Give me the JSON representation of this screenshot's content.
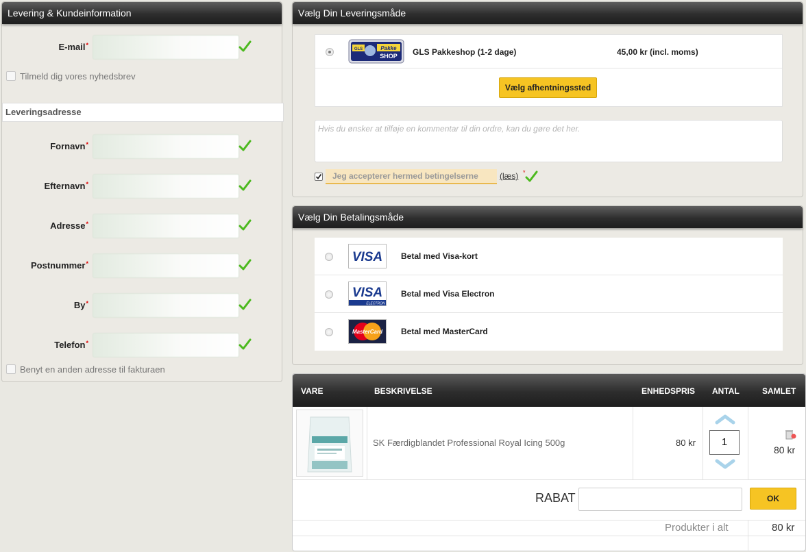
{
  "left_panel": {
    "title": "Levering & Kundeinformation",
    "email_label": "E-mail",
    "email_value": "",
    "newsletter_label": "Tilmeld dig vores nyhedsbrev",
    "section_title": "Leveringsadresse",
    "fields": [
      {
        "label": "Fornavn",
        "value": ""
      },
      {
        "label": "Efternavn",
        "value": ""
      },
      {
        "label": "Adresse",
        "value": ""
      },
      {
        "label": "Postnummer",
        "value": ""
      },
      {
        "label": "By",
        "value": ""
      },
      {
        "label": "Telefon",
        "value": ""
      }
    ],
    "required_mark": "*",
    "alt_address_label": "Benyt en anden adresse til fakturaen"
  },
  "shipping": {
    "title": "Vælg Din Leveringsmåde",
    "logo_small": "GLS",
    "logo_top": "Pakke",
    "logo_bottom": "SHOP",
    "option_name": "GLS Pakkeshop (1-2 dage)",
    "option_price": "45,00 kr (incl. moms)",
    "pickup_button": "Vælg afhentningssted",
    "comment_placeholder": "Hvis du ønsker at tilføje en kommentar til din ordre, kan du gøre det her.",
    "terms_label": "Jeg accepterer hermed betingelserne",
    "terms_link": "(læs)",
    "terms_checked": true
  },
  "payment": {
    "title": "Vælg Din Betalingsmåde",
    "options": [
      {
        "label": "Betal med Visa-kort",
        "logo": "VISA"
      },
      {
        "label": "Betal med Visa Electron",
        "logo": "VISA",
        "logo_sub": "ELECTRON"
      },
      {
        "label": "Betal med MasterCard",
        "logo": "MasterCard"
      }
    ]
  },
  "cart": {
    "headers": {
      "item": "VARE",
      "description": "BESKRIVELSE",
      "unit_price": "ENHEDSPRIS",
      "qty": "ANTAL",
      "total": "SAMLET"
    },
    "items": [
      {
        "description": "SK Færdigblandet Professional Royal Icing 500g",
        "unit_price": "80 kr",
        "qty": "1",
        "total": "80 kr"
      }
    ],
    "discount_label": "RABAT",
    "discount_value": "",
    "ok_button": "OK",
    "products_total_label": "Produkter i alt",
    "products_total_value": "80 kr"
  },
  "colors": {
    "header_dark": "#2e2e2e",
    "accent_yellow": "#f6c423",
    "check_green": "#4cb91e",
    "required_red": "#dd0000"
  }
}
